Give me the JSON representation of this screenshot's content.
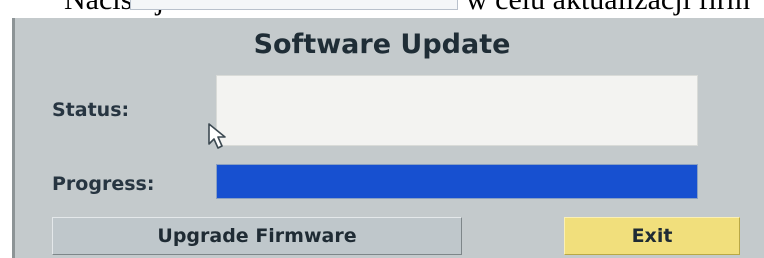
{
  "caption": {
    "left_text": "Naciśnij",
    "right_text": "w celu aktualizacji firm"
  },
  "dialog": {
    "title": "Software Update",
    "status_label": "Status:",
    "status_value": "",
    "progress_label": "Progress:",
    "progress_fraction": 1.0,
    "upgrade_label": "Upgrade Firmware",
    "exit_label": "Exit"
  },
  "icons": {
    "cursor": "mouse-pointer-icon"
  },
  "colors": {
    "panel": "#c4cacc",
    "progress_fill": "#1750d0",
    "exit_button": "#f1df7c",
    "upgrade_button": "#bfc7cb"
  }
}
